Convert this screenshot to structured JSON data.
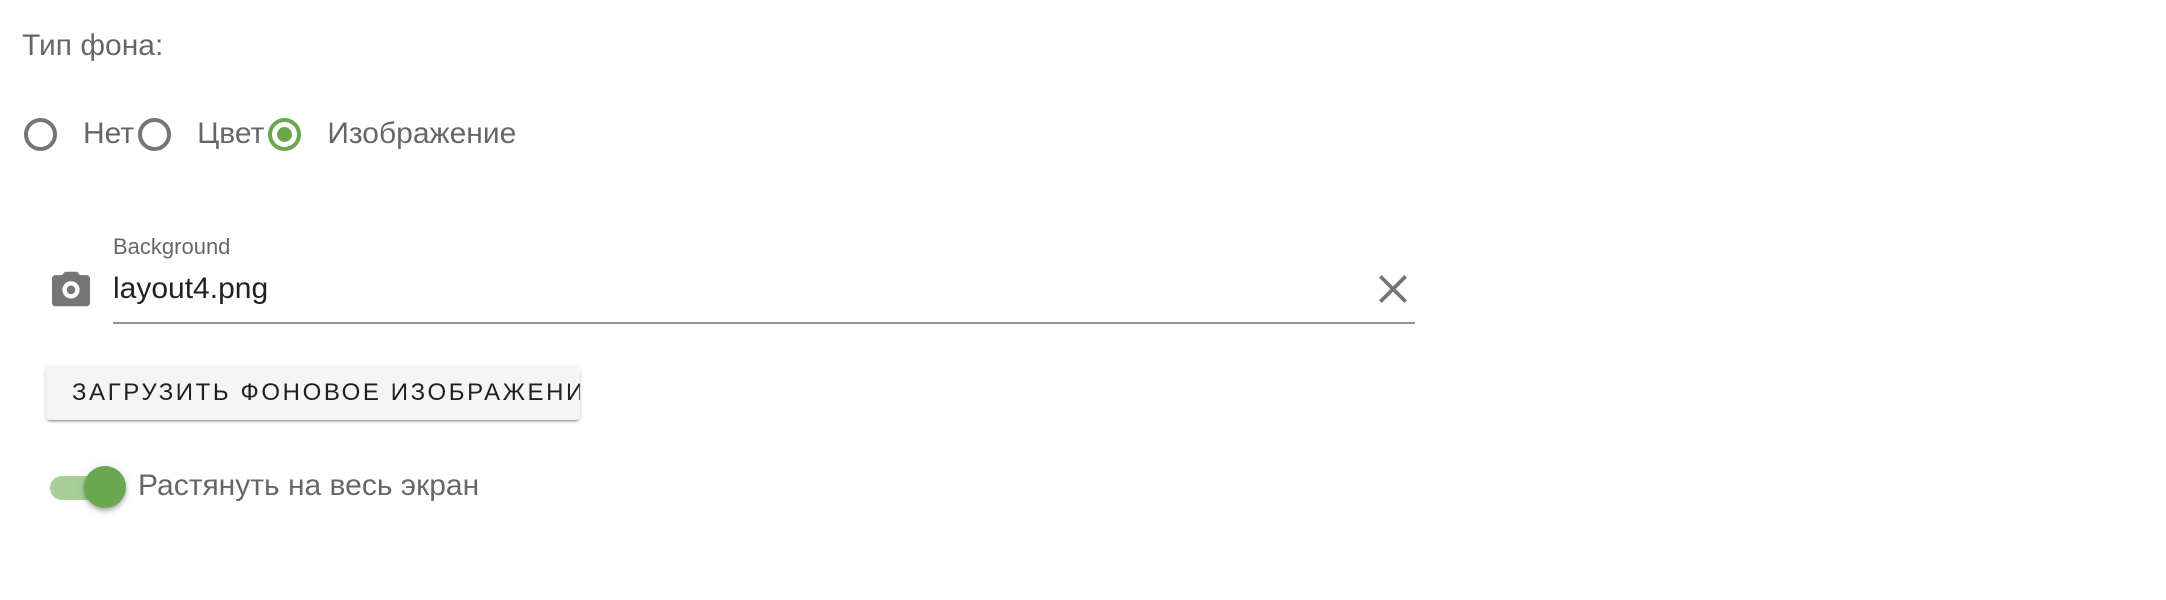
{
  "background_type": {
    "label": "Тип фона:",
    "options": [
      {
        "label": "Нет",
        "checked": false
      },
      {
        "label": "Цвет",
        "checked": false
      },
      {
        "label": "Изображение",
        "checked": true
      }
    ]
  },
  "file_field": {
    "label": "Background",
    "value": "layout4.png",
    "prefix_icon": "camera-icon",
    "clear_icon": "close-icon"
  },
  "upload_button": {
    "label": "ЗАГРУЗИТЬ ФОНОВОЕ ИЗОБРАЖЕНИ"
  },
  "stretch_switch": {
    "label": "Растянуть на весь экран",
    "on": true
  },
  "colors": {
    "accent": "#6aa84f",
    "accent_track": "#a9cf98",
    "text_secondary": "#666666",
    "text_primary": "#212121"
  }
}
